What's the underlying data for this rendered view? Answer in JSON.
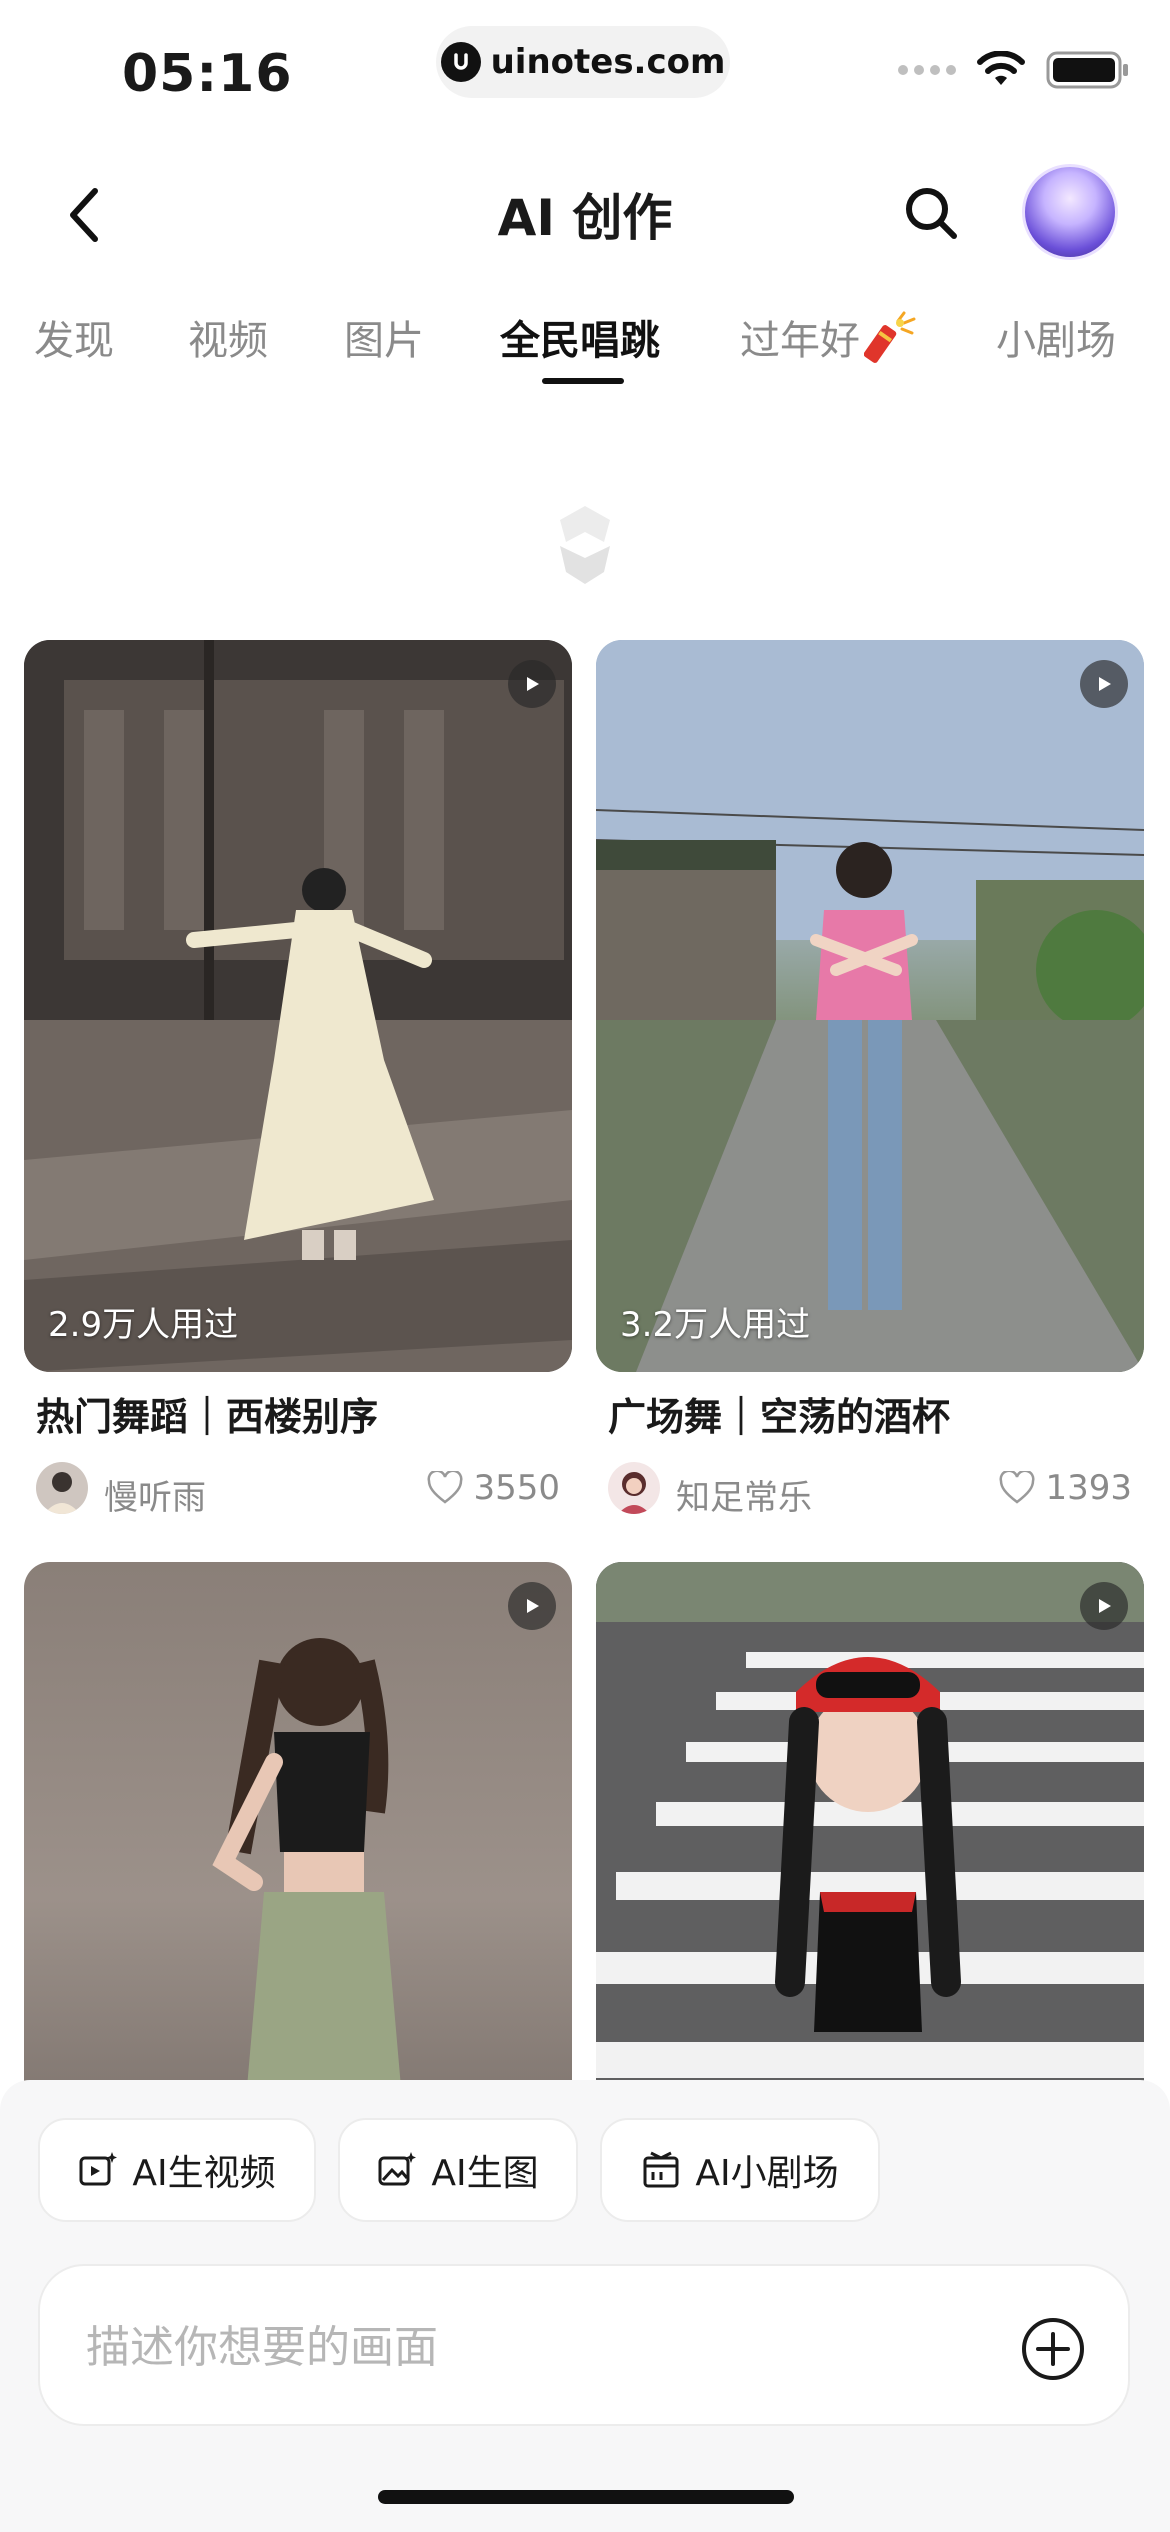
{
  "status": {
    "time": "05:16",
    "url": "uinotes.com"
  },
  "header": {
    "title": "AI 创作"
  },
  "tabs": [
    {
      "label": "发现"
    },
    {
      "label": "视频"
    },
    {
      "label": "图片"
    },
    {
      "label": "全民唱跳",
      "active": true
    },
    {
      "label": "过年好"
    },
    {
      "label": "小剧场"
    }
  ],
  "cards": [
    {
      "usage": "2.9万人用过",
      "title": "热门舞蹈｜西楼别序",
      "author": "慢听雨",
      "likes": "3550"
    },
    {
      "usage": "3.2万人用过",
      "title": "广场舞｜空荡的酒杯",
      "author": "知足常乐",
      "likes": "1393"
    },
    {
      "usage": "",
      "title": "",
      "author": "",
      "likes": ""
    },
    {
      "usage": "",
      "title": "",
      "author": "",
      "likes": ""
    }
  ],
  "actions": {
    "video": "AI生视频",
    "image": "AI生图",
    "theater": "AI小剧场"
  },
  "prompt": {
    "placeholder": "描述你想要的画面"
  },
  "icons": {
    "back": "chevron-left-icon",
    "search": "search-icon",
    "play": "play-icon",
    "heart": "heart-icon",
    "plus": "plus-circle-icon",
    "firecracker": "firecracker-icon"
  },
  "colors": {
    "text": "#1a1a1a",
    "muted": "#8a8a8a",
    "tab_inactive": "#8a8a8a",
    "accent_red": "#e0352b"
  }
}
